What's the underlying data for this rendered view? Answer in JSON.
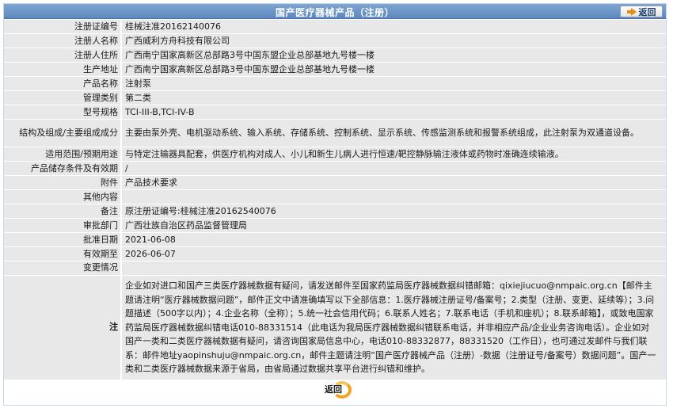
{
  "header": {
    "title": "国产医疗器械产品（注册）",
    "back_label": "返回"
  },
  "rows": [
    {
      "label": "注册证编号",
      "value": "桂械注准20162140076"
    },
    {
      "label": "注册人名称",
      "value": "广西威利方舟科技有限公司"
    },
    {
      "label": "注册人住所",
      "value": "广西南宁国家高新区总部路3号中国东盟企业总部基地九号楼一楼"
    },
    {
      "label": "生产地址",
      "value": "广西南宁国家高新区总部路3号中国东盟企业总部基地九号楼一楼"
    },
    {
      "label": "产品名称",
      "value": "注射泵"
    },
    {
      "label": "管理类别",
      "value": "第二类"
    },
    {
      "label": "型号规格",
      "value": "TCI-III-B,TCI-IV-B"
    },
    {
      "label": "结构及组成/主要组成成分",
      "value": "主要由泵外壳、电机驱动系统、输入系统、存储系统、控制系统、显示系统、传感监测系统和报警系统组成，此注射泵为双通道设备。"
    },
    {
      "label": "适用范围/预期用途",
      "value": "与特定注输器具配套，供医疗机构对成人、小儿和新生儿病人进行恒速/靶控静脉输注液体或药物时准确连续输液。"
    },
    {
      "label": "产品储存条件及有效期",
      "value": "/"
    },
    {
      "label": "附件",
      "value": "产品技术要求"
    },
    {
      "label": "其他内容",
      "value": ""
    },
    {
      "label": "备注",
      "value": "原注册证编号:桂械注准20162540076"
    },
    {
      "label": "审批部门",
      "value": "广西壮族自治区药品监督管理局"
    },
    {
      "label": "批准日期",
      "value": "2021-06-08"
    },
    {
      "label": "有效期至",
      "value": "2026-06-07"
    },
    {
      "label": "变更情况",
      "value": ""
    }
  ],
  "note": {
    "label": "注",
    "text": "企业如对进口和国产三类医疗器械数据有疑问，请发送邮件至国家药监局医疗器械数据纠错邮箱：qixiejiucuo@nmpaic.org.cn【邮件主题请注明“医疗器械数据问题”，邮件正文中请准确填写以下全部信息：1.医疗器械注册证号/备案号；2.类型（注册、变更、延续等）；3.问题描述（500字以内）；4.企业名称（全称）；5.统一社会信用代码；6.联系人姓名；7.联系电话（手机和座机）；8.联系邮箱】，或致电国家药监局医疗器械数据纠错电话010-88331514（此电话为我局医疗器械数据纠错联系电话，并非相应产品/企业业务咨询电话）。企业如对国产一类和二类医疗器械数据有疑问，请咨询国家局信息中心，电话010-88332877，88331520（工作日），也可通过发邮件与我们联系：邮件地址yaopinshuju@nmpaic.org.cn，邮件主题请注明“国产医疗器械产品（注册）-数据（注册证号/备案号）数据问题”。国产一类和二类医疗器械数据来源于省局，由省局通过数据共享平台进行纠错和维护。"
  },
  "footer": {
    "back_label": "返回"
  },
  "colors": {
    "title_bar": "#6a93c6",
    "row_bg": "#e8e8e8",
    "accent_orange": "#f2a21e"
  }
}
